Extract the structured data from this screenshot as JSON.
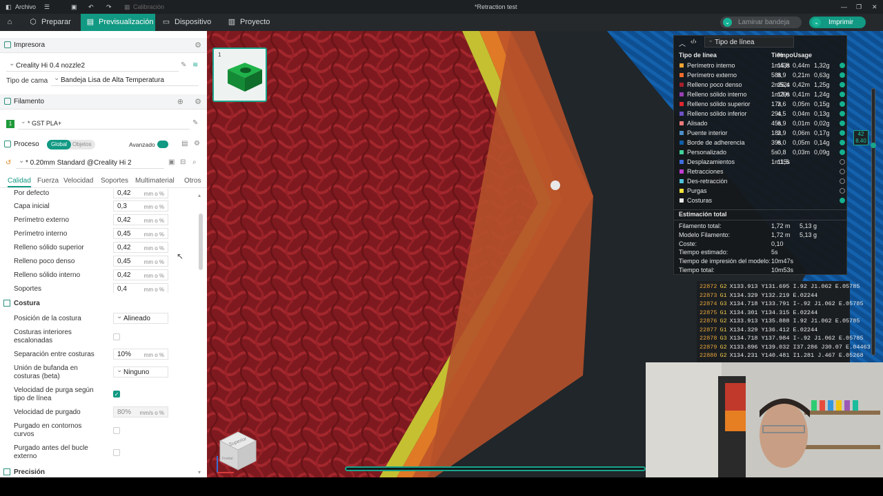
{
  "titlebar": {
    "archivo": "Archivo",
    "calibracion": "Calibración",
    "doc_title": "*Retraction test"
  },
  "toolbar": {
    "tabs": [
      {
        "label": "Preparar",
        "icon": "cube-icon"
      },
      {
        "label": "Previsualización",
        "icon": "preview-icon"
      },
      {
        "label": "Dispositivo",
        "icon": "device-icon"
      },
      {
        "label": "Proyecto",
        "icon": "project-icon"
      }
    ],
    "laminar_label": "Laminar bandeja",
    "imprimir_label": "Imprimir"
  },
  "printer": {
    "section_title": "Impresora",
    "printer_name": "Creality Hi 0.4 nozzle2",
    "bed_type_label": "Tipo de cama",
    "bed_type_value": "Bandeja Lisa de Alta Temperatura"
  },
  "filament": {
    "section_title": "Filamento",
    "slot": "1",
    "name": "* GST PLA+"
  },
  "process": {
    "section_title": "Proceso",
    "global_label": "Global",
    "objetos_label": "Objetos",
    "avanzado_label": "Avanzado",
    "preset": "* 0.20mm Standard @Creality Hi 2"
  },
  "subtabs": [
    "Calidad",
    "Fuerza",
    "Velocidad",
    "Soportes",
    "Multimaterial",
    "Otros"
  ],
  "widths": [
    {
      "label": "Por defecto",
      "value": "0,42",
      "unit": "mm o %"
    },
    {
      "label": "Capa inicial",
      "value": "0,3",
      "unit": "mm o %"
    },
    {
      "label": "Perímetro externo",
      "value": "0,42",
      "unit": "mm o %"
    },
    {
      "label": "Perímetro interno",
      "value": "0,45",
      "unit": "mm o %"
    },
    {
      "label": "Relleno sólido superior",
      "value": "0,42",
      "unit": "mm o %"
    },
    {
      "label": "Relleno poco denso",
      "value": "0,45",
      "unit": "mm o %"
    },
    {
      "label": "Relleno sólido interno",
      "value": "0,42",
      "unit": "mm o %"
    },
    {
      "label": "Soportes",
      "value": "0,4",
      "unit": "mm o %"
    }
  ],
  "costura": {
    "section_title": "Costura",
    "posicion_label": "Posición de la costura",
    "posicion_value": "Alineado",
    "interiores_label": "Costuras interiores escalonadas",
    "separacion_label": "Separación entre costuras",
    "separacion_value": "10%",
    "separacion_unit": "mm o %",
    "bufanda_label": "Unión de bufanda en costuras (beta)",
    "bufanda_value": "Ninguno",
    "velpurga_tipo_label": "Velocidad de purga según tipo de línea",
    "velpurga_label": "Velocidad de purgado",
    "velpurga_value": "80%",
    "velpurga_unit": "mm/s o %",
    "contornos_label": "Purgado en contornos curvos",
    "bucle_label": "Purgado antes del bucle externo"
  },
  "precision": {
    "section_title": "Precisión"
  },
  "thumbnail": {
    "plate_number": "1"
  },
  "legend": {
    "dropdown": "Tipo de línea",
    "headers": {
      "tipo": "Tipo de línea",
      "tiempo": "Tiempo",
      "pct": "%",
      "usage": "Usage"
    },
    "rows": [
      {
        "name": "Perímetro interno",
        "color": "#f2a433",
        "time": "1m43s",
        "pct": "15,8",
        "len": "0,44m",
        "weight": "1,32g",
        "visible": true
      },
      {
        "name": "Perímetro externo",
        "color": "#f26b2a",
        "time": "58s",
        "pct": "8,9",
        "len": "0,21m",
        "weight": "0,63g",
        "visible": true
      },
      {
        "name": "Relleno poco denso",
        "color": "#a8202a",
        "time": "2m52s",
        "pct": "26,4",
        "len": "0,42m",
        "weight": "1,25g",
        "visible": true
      },
      {
        "name": "Relleno sólido interno",
        "color": "#9a3fb5",
        "time": "1m29s",
        "pct": "13,6",
        "len": "0,41m",
        "weight": "1,24g",
        "visible": true
      },
      {
        "name": "Relleno sólido superior",
        "color": "#e0262f",
        "time": "17s",
        "pct": "2,6",
        "len": "0,05m",
        "weight": "0,15g",
        "visible": true
      },
      {
        "name": "Relleno sólido inferior",
        "color": "#6f52c8",
        "time": "29s",
        "pct": "4,5",
        "len": "0,04m",
        "weight": "0,13g",
        "visible": true
      },
      {
        "name": "Alisado",
        "color": "#f07a7a",
        "time": "45s",
        "pct": "6,9",
        "len": "0,01m",
        "weight": "0,02g",
        "visible": true
      },
      {
        "name": "Puente interior",
        "color": "#4d8fc9",
        "time": "18s",
        "pct": "2,9",
        "len": "0,06m",
        "weight": "0,17g",
        "visible": true
      },
      {
        "name": "Borde de adherencia",
        "color": "#0f5ea8",
        "time": "39s",
        "pct": "6,0",
        "len": "0,05m",
        "weight": "0,14g",
        "visible": true
      },
      {
        "name": "Personalizado",
        "color": "#41d49b",
        "time": "5s",
        "pct": "0,8",
        "len": "0,03m",
        "weight": "0,09g",
        "visible": true
      },
      {
        "name": "Desplazamientos",
        "color": "#3d6de0",
        "time": "1m15s",
        "pct": "11,5",
        "len": "",
        "weight": "",
        "visible": false
      },
      {
        "name": "Retracciones",
        "color": "#c43bd6",
        "time": "",
        "pct": "",
        "len": "",
        "weight": "",
        "visible": false
      },
      {
        "name": "Des-retracción",
        "color": "#4fc3d9",
        "time": "",
        "pct": "",
        "len": "",
        "weight": "",
        "visible": false
      },
      {
        "name": "Purgas",
        "color": "#f2e13a",
        "time": "",
        "pct": "",
        "len": "",
        "weight": "",
        "visible": false
      },
      {
        "name": "Costuras",
        "color": "#e8e8e8",
        "time": "",
        "pct": "",
        "len": "",
        "weight": "",
        "visible": true
      }
    ],
    "estimate_title": "Estimación total",
    "estimates": [
      {
        "label": "Filamento total:",
        "v1": "1,72 m",
        "v2": "5,13 g"
      },
      {
        "label": "Modelo Filamento:",
        "v1": "1,72 m",
        "v2": "5,13 g"
      },
      {
        "label": "Coste:",
        "v1": "0,10",
        "v2": ""
      },
      {
        "label": "Tiempo estimado:",
        "v1": "5s",
        "v2": ""
      },
      {
        "label": "Tiempo de impresión del modelo:",
        "v1": "10m47s",
        "v2": ""
      },
      {
        "label": "Tiempo total:",
        "v1": "10m53s",
        "v2": ""
      }
    ]
  },
  "gcode": [
    {
      "n": "22872",
      "cmd": "G2",
      "args": "X133.913 Y131.695 I.92 J1.062 E.05785"
    },
    {
      "n": "22873",
      "cmd": "G1",
      "args": "X134.329 Y132.219 E.02244"
    },
    {
      "n": "22874",
      "cmd": "G3",
      "args": "X134.718 Y133.791 I-.92 J1.062 E.05785"
    },
    {
      "n": "22875",
      "cmd": "G1",
      "args": "X134.301 Y134.315 E.02244"
    },
    {
      "n": "22876",
      "cmd": "G2",
      "args": "X133.913 Y135.888 I.92 J1.062 E.05785"
    },
    {
      "n": "22877",
      "cmd": "G1",
      "args": "X134.329 Y136.412 E.02244"
    },
    {
      "n": "22878",
      "cmd": "G3",
      "args": "X134.718 Y137.984 I-.92 J1.062 E.05785"
    },
    {
      "n": "22879",
      "cmd": "G2",
      "args": "X133.896 Y139.032 I37.286 J30.07 E.04463"
    },
    {
      "n": "22880",
      "cmd": "G2",
      "args": "X134.231 Y140.481 I1.281 J.467 E.05268"
    }
  ],
  "layer_slider": {
    "top": "42",
    "height": "8.40"
  },
  "view_cube": {
    "top_face": "Superior",
    "front_face": "Frontal"
  }
}
